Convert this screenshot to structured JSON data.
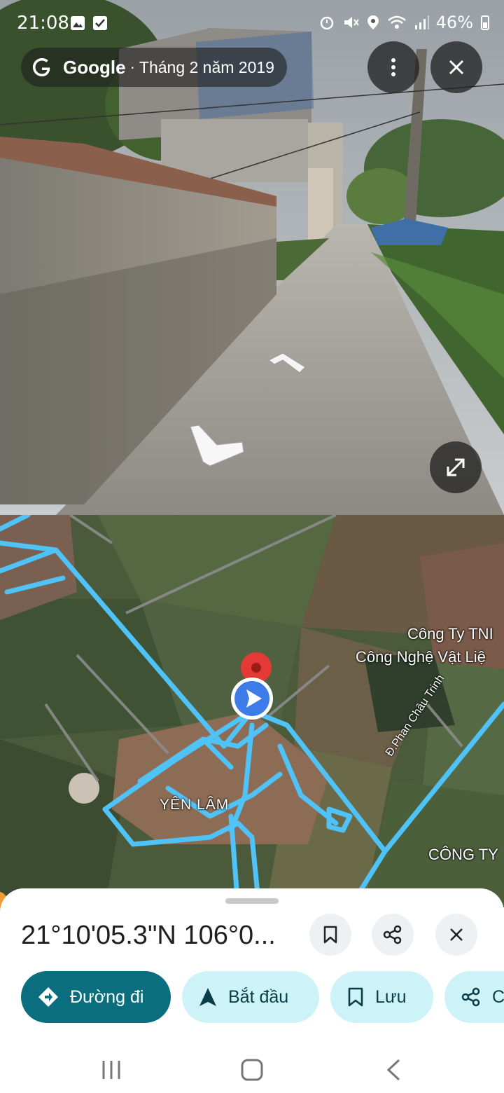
{
  "status_bar": {
    "time": "21:08",
    "battery": "46%",
    "icons": [
      "gallery-icon",
      "checkbox-icon",
      "alarm-icon",
      "mute-icon",
      "location-icon",
      "wifi-icon",
      "signal-icon",
      "battery-icon"
    ]
  },
  "street_view": {
    "brand": "Google",
    "separator": "·",
    "capture_date": "Tháng 2 năm 2019",
    "buttons": [
      "more-options",
      "close",
      "expand"
    ]
  },
  "map": {
    "labels": {
      "company1": "Công Ty TNI",
      "company2": "Công Nghệ Vật Liệ",
      "village": "YÊN LÂM",
      "road": "Đ.Phan Châu Trinh",
      "company3": "CÔNG TY"
    },
    "colors": {
      "road_overlay": "#4fc3f7",
      "pin": "#e53935",
      "viewer": "#3d7be8"
    }
  },
  "sheet": {
    "coordinates": "21°10'05.3\"N 106°0...",
    "chips": {
      "directions": "Đường đi",
      "start": "Bắt đầu",
      "save": "Lưu",
      "share": "C"
    },
    "colors": {
      "primary_chip": "#0b6e7e",
      "secondary_chip": "#cdf2f8"
    }
  }
}
